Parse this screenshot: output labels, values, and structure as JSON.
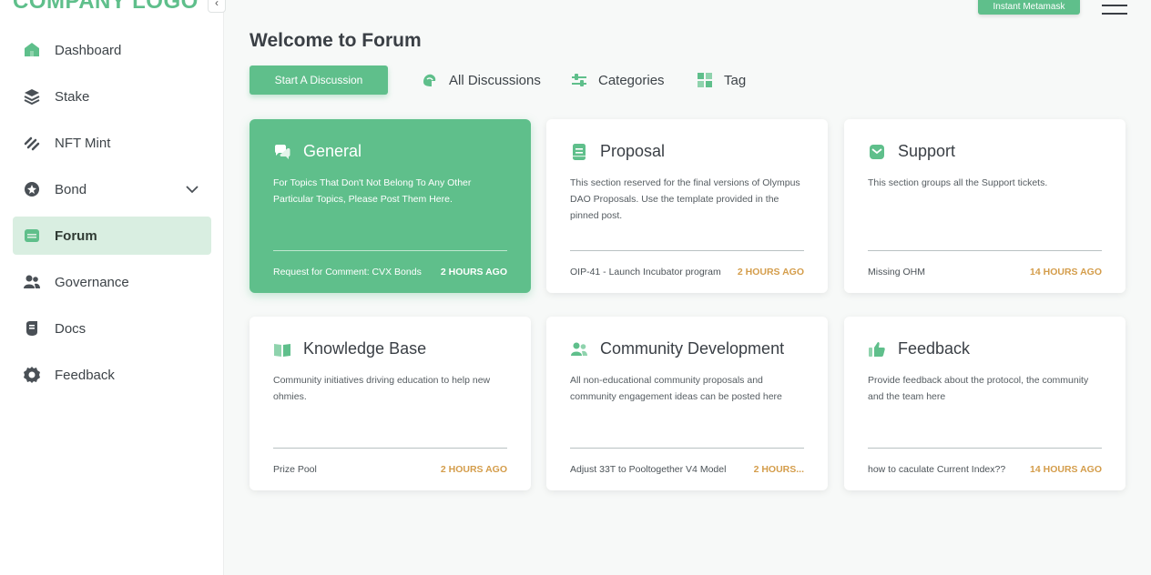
{
  "brand": {
    "logo_text": "COMPANY LOGO",
    "accent": "#5fbf8b",
    "time_color": "#d49d4b"
  },
  "sidebar": {
    "collapse_icon": "chevron-left-icon",
    "items": [
      {
        "label": "Dashboard",
        "icon": "home-icon",
        "active": false
      },
      {
        "label": "Stake",
        "icon": "layers-icon",
        "active": false
      },
      {
        "label": "NFT Mint",
        "icon": "stripes-icon",
        "active": false
      },
      {
        "label": "Bond",
        "icon": "bond-icon",
        "active": false,
        "expandable": true
      },
      {
        "label": "Forum",
        "icon": "forum-icon",
        "active": true
      },
      {
        "label": "Governance",
        "icon": "people-icon",
        "active": false
      },
      {
        "label": "Docs",
        "icon": "docs-icon",
        "active": false
      },
      {
        "label": "Feedback",
        "icon": "gear-icon",
        "active": false
      }
    ]
  },
  "header": {
    "wallet_button": "Instant Metamask",
    "menu_icon": "hamburger-icon"
  },
  "main": {
    "title": "Welcome to Forum",
    "start_button": "Start A Discussion",
    "filters": [
      {
        "label": "All Discussions",
        "icon": "discussions-icon"
      },
      {
        "label": "Categories",
        "icon": "sliders-icon"
      },
      {
        "label": "Tag",
        "icon": "grid-icon"
      }
    ],
    "cards": [
      {
        "title": "General",
        "icon": "chat-icon",
        "active": true,
        "description": "For Topics That Don't Not Belong To Any Other Particular Topics, Please Post Them Here.",
        "latest": "Request for Comment: CVX Bonds",
        "time": "2 HOURS AGO"
      },
      {
        "title": "Proposal",
        "icon": "document-icon",
        "active": false,
        "description": "This section reserved for the final versions of Olympus DAO Proposals. Use the template provided in the pinned post.",
        "latest": "OIP-41 - Launch Incubator program",
        "time": "2 HOURS AGO"
      },
      {
        "title": "Support",
        "icon": "mail-icon",
        "active": false,
        "description": "This section groups all the Support tickets.",
        "latest": "Missing OHM",
        "time": "14 HOURS AGO"
      },
      {
        "title": "Knowledge Base",
        "icon": "book-icon",
        "active": false,
        "description": "Community initiatives driving education to help new ohmies.",
        "latest": "Prize Pool",
        "time": "2 HOURS AGO"
      },
      {
        "title": "Community Development",
        "icon": "community-icon",
        "active": false,
        "description": "All non-educational community proposals and community engagement ideas can be posted here",
        "latest": "Adjust 33T to Pooltogether V4 Model",
        "time": "2 HOURS..."
      },
      {
        "title": "Feedback",
        "icon": "thumbs-up-icon",
        "active": false,
        "description": "Provide feedback about the protocol, the community and the team here",
        "latest": "how to caculate Current Index??",
        "time": "14 HOURS AGO"
      }
    ]
  }
}
